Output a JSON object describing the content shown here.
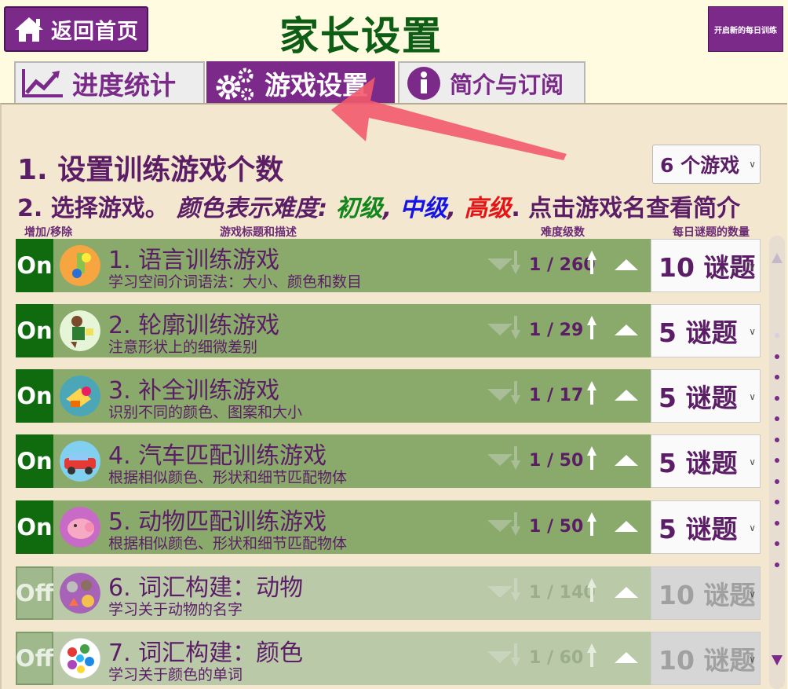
{
  "header": {
    "home_label": "返回首页",
    "title": "家长设置",
    "daily_label": "开启新的每日训练"
  },
  "tabs": [
    {
      "label": "进度统计",
      "active": false
    },
    {
      "label": "游戏设置",
      "active": true
    },
    {
      "label": "简介与订阅",
      "active": false
    }
  ],
  "settings": {
    "step1": "1. 设置训练游戏个数",
    "game_count_value": "6 个游戏",
    "step2_a": "2. 选择游戏。",
    "step2_b": "颜色表示难度:",
    "level_easy": "初级",
    "level_mid": "中级",
    "level_hard": "高级",
    "step2_c": ". 点击游戏名查看简介",
    "colors": {
      "easy": "#12861a",
      "mid": "#1414e6",
      "hard": "#e61414"
    }
  },
  "columns": {
    "toggle": "增加/移除",
    "title": "游戏标题和描述",
    "difficulty": "难度级数",
    "daily": "每日谜题的数量"
  },
  "games": [
    {
      "toggle": "On",
      "title": "1. 语言训练游戏",
      "desc": "学习空间介词语法：大小、颜色和数目",
      "level": "1 / 260",
      "quantity": "10 谜题",
      "icon": "language-icon"
    },
    {
      "toggle": "On",
      "title": "2. 轮廓训练游戏",
      "desc": "注意形状上的细微差别",
      "level": "1 / 29",
      "quantity": "5 谜题",
      "icon": "outline-icon"
    },
    {
      "toggle": "On",
      "title": "3. 补全训练游戏",
      "desc": "识别不同的颜色、图案和大小",
      "level": "1 / 17",
      "quantity": "5 谜题",
      "icon": "completion-icon"
    },
    {
      "toggle": "On",
      "title": "4. 汽车匹配训练游戏",
      "desc": "根据相似颜色、形状和细节匹配物体",
      "level": "1 / 50",
      "quantity": "5 谜题",
      "icon": "car-icon"
    },
    {
      "toggle": "On",
      "title": "5. 动物匹配训练游戏",
      "desc": "根据相似颜色、形状和细节匹配物体",
      "level": "1 / 50",
      "quantity": "5 谜题",
      "icon": "pig-icon"
    },
    {
      "toggle": "Off",
      "title": "6. 词汇构建：动物",
      "desc": "学习关于动物的名字",
      "level": "1 / 140",
      "quantity": "10 谜题",
      "icon": "animals-icon"
    },
    {
      "toggle": "Off",
      "title": "7. 词汇构建：颜色",
      "desc": "学习关于颜色的单词",
      "level": "1 / 60",
      "quantity": "10 谜题",
      "icon": "colors-icon"
    }
  ]
}
